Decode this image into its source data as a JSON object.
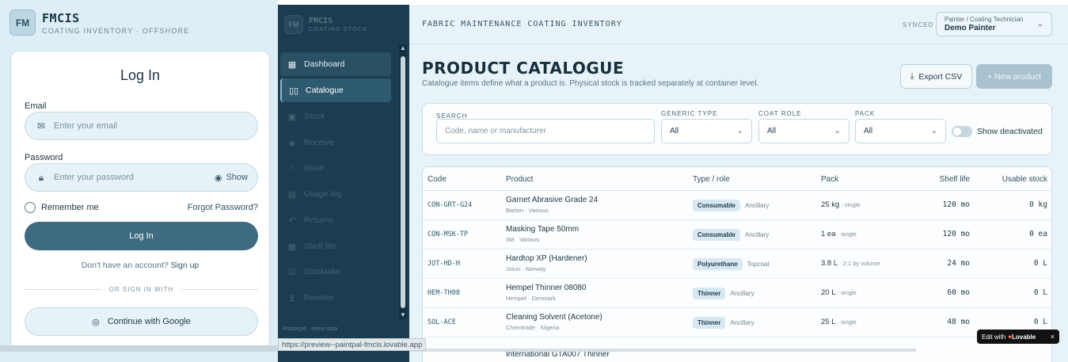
{
  "brand": {
    "logo": "FM",
    "name": "FMCIS",
    "subtitle": "COATING INVENTORY · OFFSHORE"
  },
  "login": {
    "title": "Log In",
    "email_label": "Email",
    "email_placeholder": "Enter your email",
    "password_label": "Password",
    "password_placeholder": "Enter your password",
    "show_label": "Show",
    "remember_label": "Remember me",
    "forgot_label": "Forgot Password?",
    "login_button": "Log In",
    "signup_prompt": "Don't have an account?",
    "signup_link": "Sign up",
    "or_label": "OR SIGN IN WITH",
    "google_button": "Continue with Google"
  },
  "sidebar": {
    "logo": "FM",
    "brand": "FMCIS",
    "brand_sub": "COATING STOCK",
    "items": [
      {
        "label": "Dashboard",
        "icon": "grid-icon"
      },
      {
        "label": "Catalogue",
        "icon": "book-icon"
      },
      {
        "label": "Stock",
        "icon": "boxes-icon"
      },
      {
        "label": "Receive",
        "icon": "receive-icon"
      },
      {
        "label": "Issue",
        "icon": "issue-icon"
      },
      {
        "label": "Usage log",
        "icon": "clipboard-icon"
      },
      {
        "label": "Returns",
        "icon": "return-icon"
      },
      {
        "label": "Shelf life",
        "icon": "calendar-icon"
      },
      {
        "label": "Stocktake",
        "icon": "checklist-icon"
      },
      {
        "label": "Reorder",
        "icon": "cart-icon"
      }
    ],
    "footer": "Prototype · demo data"
  },
  "topbar": {
    "title": "FABRIC MAINTENANCE COATING INVENTORY",
    "synced": "SYNCED",
    "user_role": "Painter / Coating Technician",
    "user_name": "Demo Painter"
  },
  "page": {
    "title": "PRODUCT CATALOGUE",
    "subtitle": "Catalogue items define what a product is. Physical stock is tracked separately at container level.",
    "export_button": "Export CSV",
    "new_button": "+ New product"
  },
  "filters": {
    "search_label": "SEARCH",
    "search_placeholder": "Code, name or manufacturer",
    "generic_type_label": "GENERIC TYPE",
    "generic_type_value": "All",
    "coat_role_label": "COAT ROLE",
    "coat_role_value": "All",
    "pack_label": "PACK",
    "pack_value": "All",
    "show_deactivated": "Show deactivated"
  },
  "table": {
    "headers": [
      "Code",
      "Product",
      "Type / role",
      "Pack",
      "Shelf life",
      "Usable stock"
    ],
    "rows": [
      {
        "code": "CON-GRT-G24",
        "name": "Garnet Abrasive Grade 24",
        "mfr": "Barton · Various",
        "type": "Consumable",
        "role": "Ancillary",
        "pack": "25 kg",
        "pack_note": " · single",
        "shelf": "120 mo",
        "stock": "0 kg"
      },
      {
        "code": "CON-MSK-TP",
        "name": "Masking Tape 50mm",
        "mfr": "3M · Various",
        "type": "Consumable",
        "role": "Ancillary",
        "pack": "1 ea",
        "pack_note": " · single",
        "shelf": "120 mo",
        "stock": "0 ea"
      },
      {
        "code": "JOT-HD-H",
        "name": "Hardtop XP (Hardener)",
        "mfr": "Jotun · Norway",
        "type": "Polyurethane",
        "role": "Topcoat",
        "pack": "3.8 L",
        "pack_note": " · 2:1 by volume",
        "shelf": "24 mo",
        "stock": "0 L"
      },
      {
        "code": "HEM-TH08",
        "name": "Hempel Thinner 08080",
        "mfr": "Hempel · Denmark",
        "type": "Thinner",
        "role": "Ancillary",
        "pack": "20 L",
        "pack_note": " · single",
        "shelf": "60 mo",
        "stock": "0 L"
      },
      {
        "code": "SOL-ACE",
        "name": "Cleaning Solvent (Acetone)",
        "mfr": "Chemtrade · Nigeria",
        "type": "Thinner",
        "role": "Ancillary",
        "pack": "25 L",
        "pack_note": " · single",
        "shelf": "48 mo",
        "stock": "0 L"
      }
    ],
    "partial_row": "International GTA007 Thinner"
  },
  "overlay": {
    "url": "https://preview--paintpal-fmcis.lovable.app",
    "lovable_prefix": "Edit with",
    "lovable_brand": "Lovable",
    "close": "×"
  }
}
